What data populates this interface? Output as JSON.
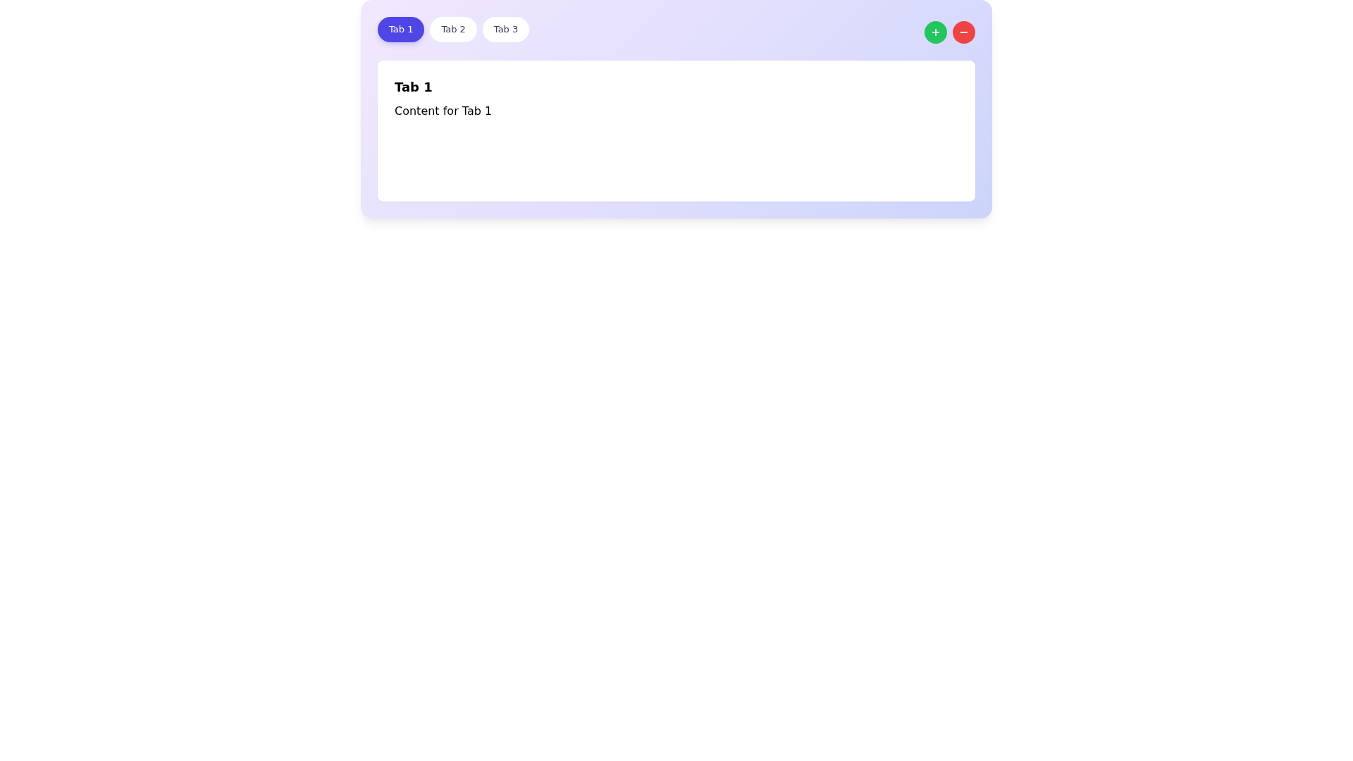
{
  "tabs": [
    {
      "label": "Tab 1",
      "selected": true
    },
    {
      "label": "Tab 2",
      "selected": false
    },
    {
      "label": "Tab 3",
      "selected": false
    }
  ],
  "actions": [
    {
      "kind": "add"
    },
    {
      "kind": "remove"
    }
  ],
  "panel": {
    "title": "Tab 1",
    "content": "Content for Tab 1"
  }
}
